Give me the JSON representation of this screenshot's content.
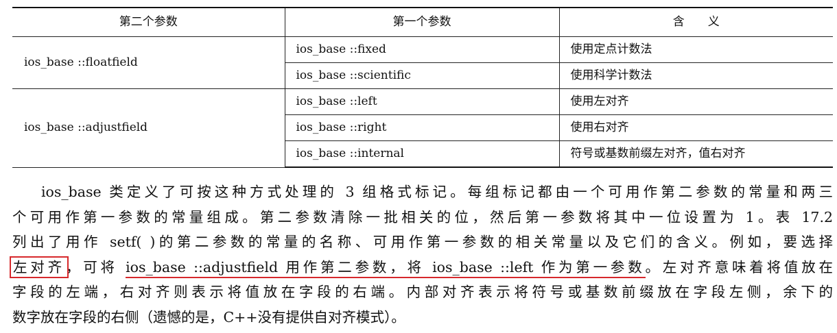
{
  "table": {
    "headers": [
      "第二个参数",
      "第一个参数",
      "含　　义"
    ],
    "groups": [
      {
        "second": "ios_base ::floatfield",
        "rows": [
          {
            "first": "ios_base ::fixed",
            "meaning": "使用定点计数法"
          },
          {
            "first": "ios_base ::scientific",
            "meaning": "使用科学计数法"
          }
        ]
      },
      {
        "second": "ios_base ::adjustfield",
        "rows": [
          {
            "first": "ios_base ::left",
            "meaning": "使用左对齐"
          },
          {
            "first": "ios_base ::right",
            "meaning": "使用右对齐"
          },
          {
            "first": "ios_base ::internal",
            "meaning": "符号或基数前缀左对齐，值右对齐"
          }
        ]
      }
    ]
  },
  "paragraph": {
    "line1": "ios_base 类定义了可按这种方式处理的 3 组格式标记。每组标记都由一个可用作第二参数的常量和两三",
    "line2": "个可用作第一参数的常量组成。第二参数清除一批相关的位，然后第一参数将其中一位设置为 1。表 17.2",
    "line3": "列出了用作 setf( )的第二参数的常量的名称、可用作第一参数的相关常量以及它们的含义。例如，要选择",
    "line4_boxed": "左对齐",
    "line4_a": "，可将 ",
    "line4_underlined": "ios_base ::adjustfield 用作第二参数，将 ios_base ::left 作为第一参数",
    "line4_b": "。左对齐意味着将值放在",
    "line5": "字段的左端，右对齐则表示将值放在字段的右端。内部对齐表示将符号或基数前缀放在字段左侧，余下的",
    "line6": "数字放在字段的右侧（遗憾的是，C++没有提供自对齐模式）。"
  },
  "colors": {
    "annotation": "#d6282b"
  }
}
